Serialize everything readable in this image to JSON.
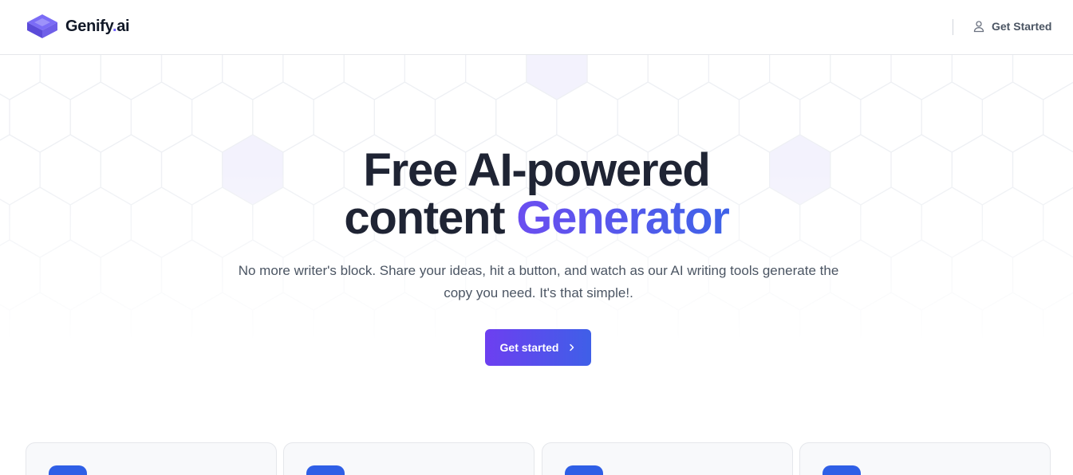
{
  "header": {
    "logo_text": "Genify",
    "logo_dot": ".",
    "logo_suffix": "ai",
    "get_started_label": "Get Started"
  },
  "hero": {
    "headline_line1": "Free AI-powered",
    "headline_line2_prefix": "content ",
    "headline_accent": "Generator",
    "subtext": "No more writer's block. Share your ideas, hit a button, and watch as our AI writing tools generate the copy you need. It's that simple!.",
    "cta_label": "Get started"
  },
  "colors": {
    "accent_start": "#6b4ef0",
    "accent_end": "#3f63e8",
    "card_icon": "#2f5fe6"
  },
  "icons": {
    "logo": "layered-cube-logo",
    "user": "user-icon",
    "cta": "chevron-right-icon"
  }
}
